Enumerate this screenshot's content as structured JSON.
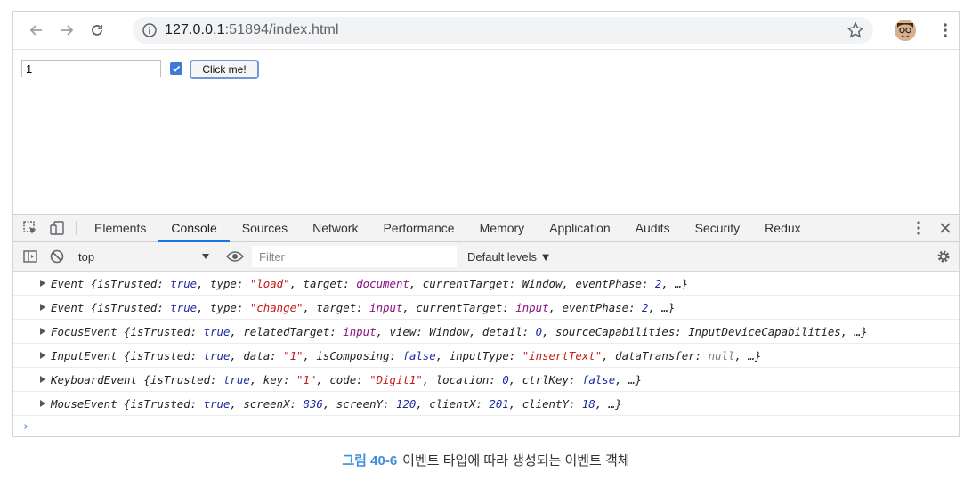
{
  "browser": {
    "url_host": "127.0.0.1",
    "url_rest": ":51894/index.html"
  },
  "page": {
    "text_input_value": "1",
    "checkbox_checked": true,
    "button_label": "Click me!"
  },
  "devtools": {
    "tabs": [
      "Elements",
      "Console",
      "Sources",
      "Network",
      "Performance",
      "Memory",
      "Application",
      "Audits",
      "Security",
      "Redux"
    ],
    "active_tab": "Console",
    "context": "top",
    "filter_placeholder": "Filter",
    "levels": "Default levels ▼"
  },
  "console": {
    "rows": [
      [
        [
          "Event {isTrusted: ",
          ""
        ],
        [
          "true",
          "b"
        ],
        [
          ", type: ",
          ""
        ],
        [
          "\"load\"",
          "r"
        ],
        [
          ", target: ",
          ""
        ],
        [
          "document",
          "p"
        ],
        [
          ", currentTarget: Window, eventPhase: ",
          ""
        ],
        [
          "2",
          "b"
        ],
        [
          ", …}",
          ""
        ]
      ],
      [
        [
          "Event {isTrusted: ",
          ""
        ],
        [
          "true",
          "b"
        ],
        [
          ", type: ",
          ""
        ],
        [
          "\"change\"",
          "r"
        ],
        [
          ", target: ",
          ""
        ],
        [
          "input",
          "p"
        ],
        [
          ", currentTarget: ",
          ""
        ],
        [
          "input",
          "p"
        ],
        [
          ", eventPhase: ",
          ""
        ],
        [
          "2",
          "b"
        ],
        [
          ", …}",
          ""
        ]
      ],
      [
        [
          "FocusEvent {isTrusted: ",
          ""
        ],
        [
          "true",
          "b"
        ],
        [
          ", relatedTarget: ",
          ""
        ],
        [
          "input",
          "p"
        ],
        [
          ", view: Window, detail: ",
          ""
        ],
        [
          "0",
          "b"
        ],
        [
          ", sourceCapabilities: InputDeviceCapabilities, …}",
          ""
        ]
      ],
      [
        [
          "InputEvent {isTrusted: ",
          ""
        ],
        [
          "true",
          "b"
        ],
        [
          ", data: ",
          ""
        ],
        [
          "\"1\"",
          "r"
        ],
        [
          ", isComposing: ",
          ""
        ],
        [
          "false",
          "b"
        ],
        [
          ", inputType: ",
          ""
        ],
        [
          "\"insertText\"",
          "r"
        ],
        [
          ", dataTransfer: ",
          ""
        ],
        [
          "null",
          "g"
        ],
        [
          ", …}",
          ""
        ]
      ],
      [
        [
          "KeyboardEvent {isTrusted: ",
          ""
        ],
        [
          "true",
          "b"
        ],
        [
          ", key: ",
          ""
        ],
        [
          "\"1\"",
          "r"
        ],
        [
          ", code: ",
          ""
        ],
        [
          "\"Digit1\"",
          "r"
        ],
        [
          ", location: ",
          ""
        ],
        [
          "0",
          "b"
        ],
        [
          ", ctrlKey: ",
          ""
        ],
        [
          "false",
          "b"
        ],
        [
          ", …}",
          ""
        ]
      ],
      [
        [
          "MouseEvent {isTrusted: ",
          ""
        ],
        [
          "true",
          "b"
        ],
        [
          ", screenX: ",
          ""
        ],
        [
          "836",
          "b"
        ],
        [
          ", screenY: ",
          ""
        ],
        [
          "120",
          "b"
        ],
        [
          ", clientX: ",
          ""
        ],
        [
          "201",
          "b"
        ],
        [
          ", clientY: ",
          ""
        ],
        [
          "18",
          "b"
        ],
        [
          ", …}",
          ""
        ]
      ]
    ],
    "prompt": "›"
  },
  "caption": {
    "number": "그림 40-6",
    "text": "이벤트 타입에 따라 생성되는 이벤트 객체"
  },
  "colors": {
    "keyword": "#1c2a9e",
    "string": "#c41a16",
    "dom_node": "#881280",
    "null": "#808080",
    "accent": "#1a73e8",
    "caption_number": "#3d8fd8"
  },
  "icons": [
    "back-arrow-icon",
    "forward-arrow-icon",
    "reload-icon",
    "info-icon",
    "star-icon",
    "avatar",
    "kebab-menu-icon",
    "inspect-icon",
    "device-toggle-icon",
    "close-icon",
    "sidebar-toggle-icon",
    "clear-console-icon",
    "eye-icon",
    "gear-icon",
    "expand-triangle-icon"
  ]
}
